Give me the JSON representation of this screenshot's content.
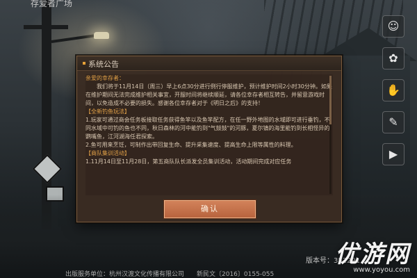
{
  "top_left_text": "存爱者广场",
  "side_icons": [
    "person-icon",
    "rabbit-icon",
    "hand-icon",
    "notes-icon",
    "play-icon"
  ],
  "dialog": {
    "title": "系统公告",
    "greeting": "亲爱的幸存者：",
    "intro": "我们将于11月14日（周三）早上6点30分进行例行停服维护，预计维护时间2小时30分钟。如果在维护期间无法完成维护相关事宜，开服时间将继续顺延，请各位幸存者相互转告，并留意游戏时间，以免造成不必要的损失。感谢各位幸存者对于《明日之后》的支持！",
    "section1_title": "【全新钓鱼玩法】",
    "section1_item1": "1.玩家可通过商会任务板接取任务获得鱼竿以及鱼竿配方，在任一野外地图的水域即可进行垂钓，不同水域中可钓的鱼也不同，秋日森林的河中能钓到\"气鼓鼓\"的河豚，夏尔镇的海里能钓到长相怪异的鹦嘴鱼，江河湖海任君探索。",
    "section1_item2": "2.鱼可用来烹饪，可制作出带回复生命、提升采集速度、提高生命上限等属性的料理。",
    "section2_title": "【商队集训活动】",
    "section2_item1": "1.11月14日至11月28日，第五商队队长派发全员集训活动，活动期间完成对应任务",
    "confirm_label": "确认"
  },
  "version_text": "版本号：352291",
  "publisher_text": "出版服务单位：杭州汉渡文化传播有限公司　　新民文〔2016〕0155-055",
  "watermark": {
    "main": "优游网",
    "sub": "www.yoyou.com"
  }
}
